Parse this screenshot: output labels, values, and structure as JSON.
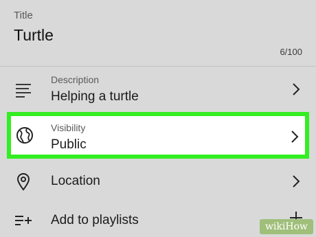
{
  "title_section": {
    "label": "Title",
    "value": "Turtle",
    "char_count": "6/100"
  },
  "rows": {
    "description": {
      "label": "Description",
      "value": "Helping a turtle",
      "icon": "description-lines-icon"
    },
    "visibility": {
      "label": "Visibility",
      "value": "Public",
      "icon": "globe-icon",
      "highlight_color": "#33ee22"
    },
    "location": {
      "value": "Location",
      "icon": "location-pin-icon"
    },
    "playlists": {
      "value": "Add to playlists",
      "icon": "playlist-add-icon"
    }
  },
  "watermark": "wikiHow"
}
